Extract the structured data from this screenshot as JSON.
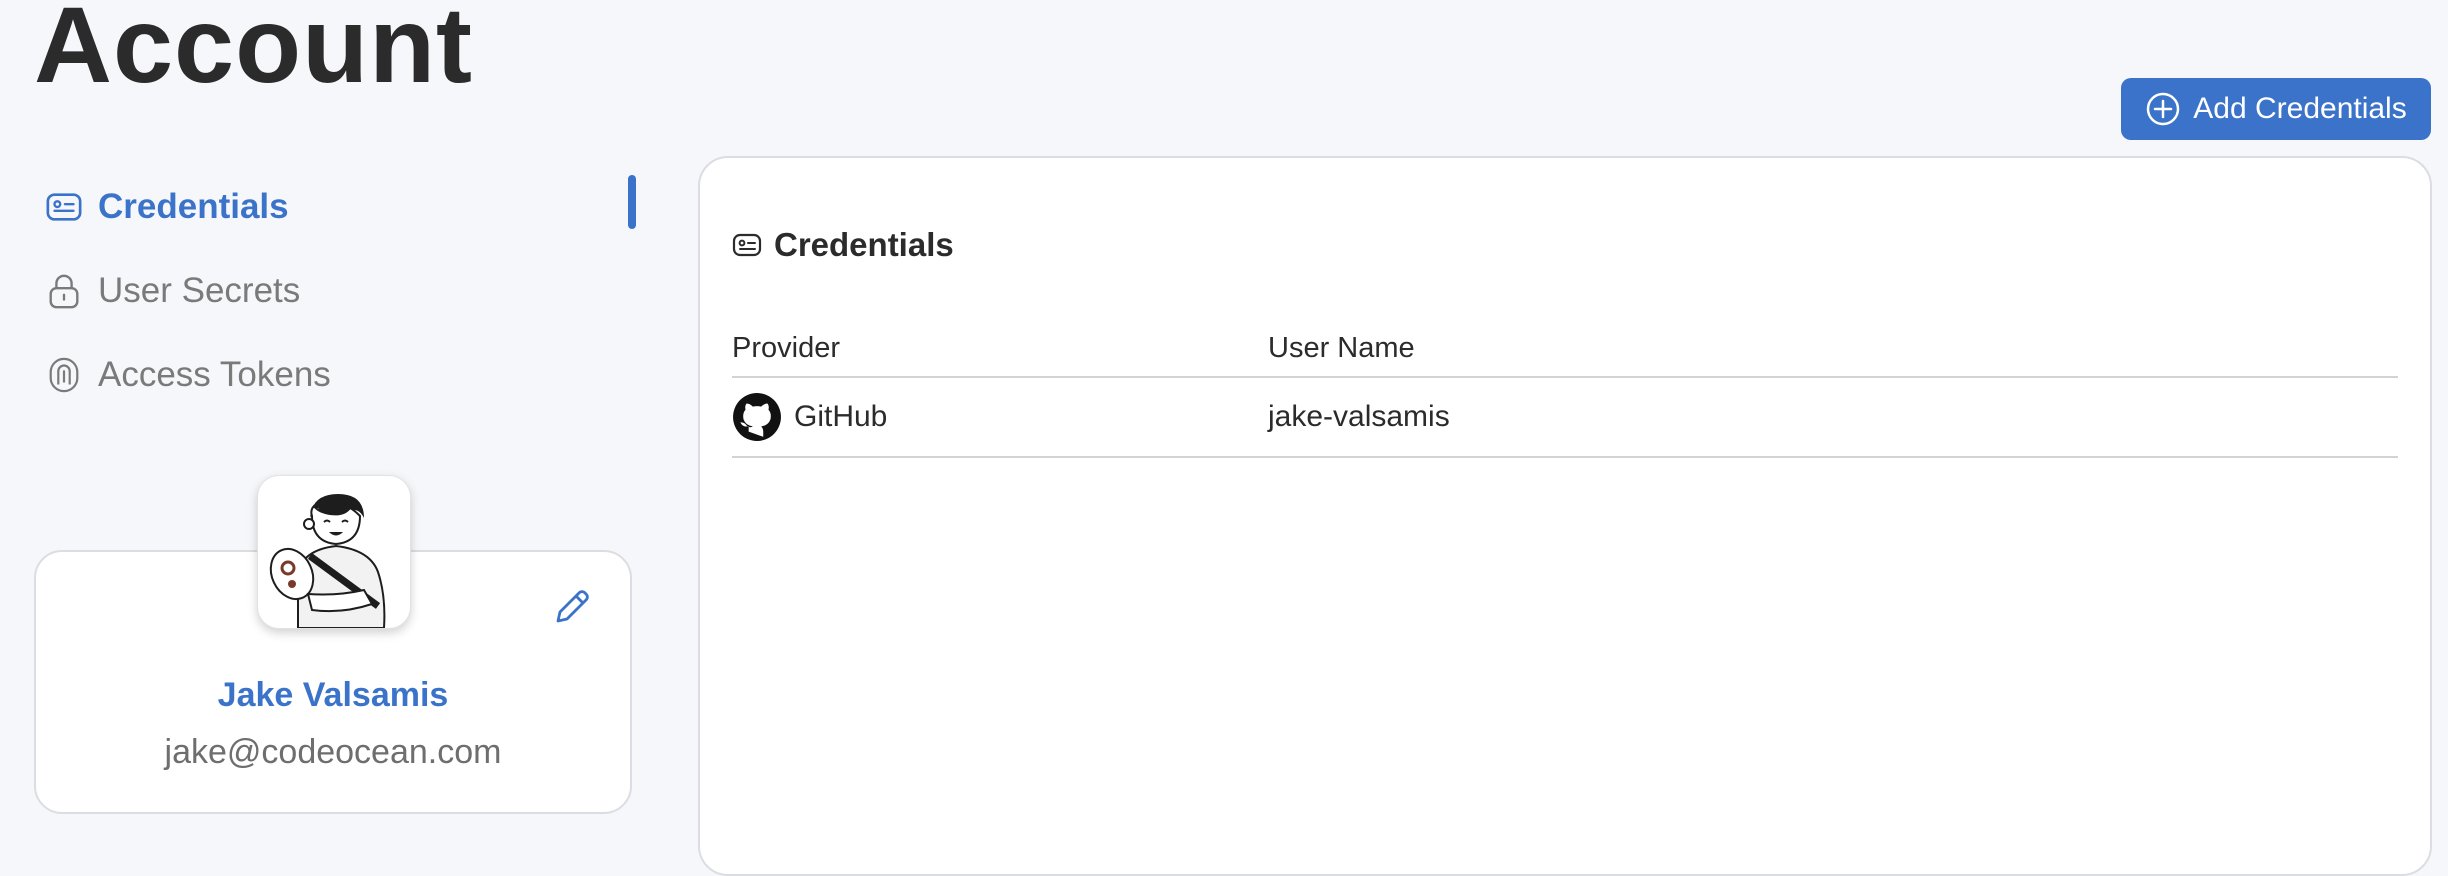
{
  "page": {
    "title": "Account"
  },
  "header": {
    "add_button_label": "Add Credentials",
    "add_icon": "plus-circle-icon"
  },
  "nav": {
    "items": [
      {
        "label": "Credentials",
        "icon": "id-card-icon",
        "active": true
      },
      {
        "label": "User Secrets",
        "icon": "lock-icon",
        "active": false
      },
      {
        "label": "Access Tokens",
        "icon": "fingerprint-icon",
        "active": false
      }
    ]
  },
  "profile": {
    "name": "Jake Valsamis",
    "email": "jake@codeocean.com",
    "edit_icon": "pencil-icon",
    "avatar": "avatar-illustration"
  },
  "panel": {
    "title": "Credentials",
    "title_icon": "id-card-icon",
    "table": {
      "headers": [
        "Provider",
        "User Name"
      ],
      "rows": [
        {
          "provider": "GitHub",
          "provider_icon": "github-icon",
          "username": "jake-valsamis"
        }
      ]
    }
  },
  "colors": {
    "accent": "#3a73c9",
    "background": "#f6f7fa",
    "text": "#2b2b2b",
    "muted": "#7a7a7a"
  }
}
